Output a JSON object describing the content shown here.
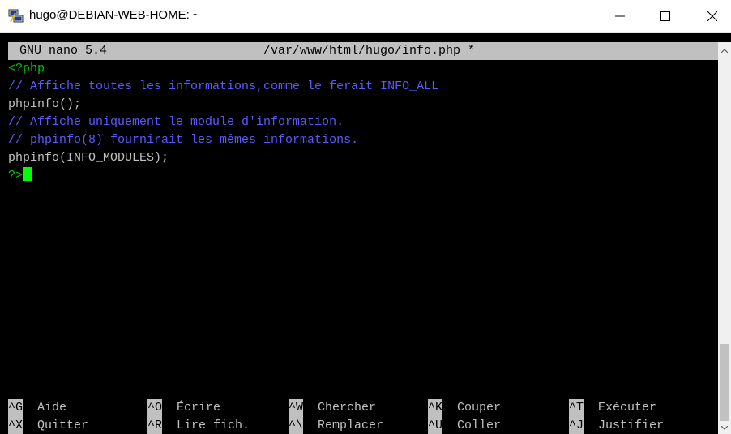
{
  "window": {
    "title": "hugo@DEBIAN-WEB-HOME: ~",
    "app_icon": "putty-icon",
    "controls": [
      "minimize-icon",
      "maximize-icon",
      "close-icon"
    ]
  },
  "nano": {
    "header": {
      "program": "GNU nano 5.4",
      "filename": "/var/www/html/hugo/info.php *"
    },
    "lines": [
      {
        "text": "<?php",
        "kind": "keyword"
      },
      {
        "text": "// Affiche toutes les informations,comme le ferait INFO_ALL",
        "kind": "comment"
      },
      {
        "text": "phpinfo();",
        "kind": "code"
      },
      {
        "text": "// Affiche uniquement le module d'information.",
        "kind": "comment"
      },
      {
        "text": "// phpinfo(8) fournirait les mêmes informations.",
        "kind": "comment"
      },
      {
        "text": "phpinfo(INFO_MODULES);",
        "kind": "code"
      },
      {
        "text": "?>",
        "kind": "keyword"
      }
    ],
    "shortcuts_row1": [
      {
        "key": "^G",
        "label": "Aide"
      },
      {
        "key": "^O",
        "label": "Écrire"
      },
      {
        "key": "^W",
        "label": "Chercher"
      },
      {
        "key": "^K",
        "label": "Couper"
      },
      {
        "key": "^T",
        "label": "Exécuter"
      }
    ],
    "shortcuts_row2": [
      {
        "key": "^X",
        "label": "Quitter"
      },
      {
        "key": "^R",
        "label": "Lire fich."
      },
      {
        "key": "^\\",
        "label": "Remplacer"
      },
      {
        "key": "^U",
        "label": "Coller"
      },
      {
        "key": "^J",
        "label": "Justifier"
      }
    ]
  },
  "colors": {
    "keyword": "#00c800",
    "comment": "#5a5aff",
    "code": "#c0c0c0",
    "cursor": "#00ff00",
    "header_bg": "#c0c0c0"
  }
}
